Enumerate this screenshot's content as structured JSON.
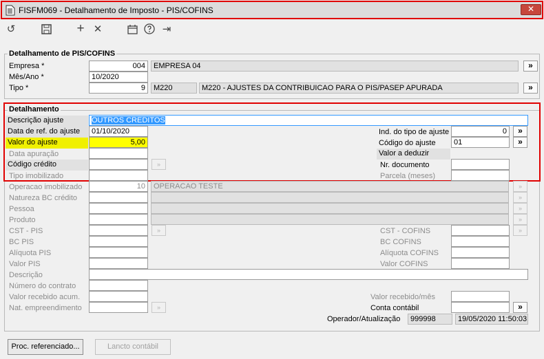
{
  "window": {
    "title": "FISFM069 - Detalhamento de Imposto - PIS/COFINS",
    "close": "✕"
  },
  "toolbar": {
    "undo": "↺",
    "add": "+",
    "delete": "✕",
    "exit": "⇥"
  },
  "header": {
    "legend": "Detalhamento de PIS/COFINS",
    "empresa_label": "Empresa *",
    "empresa_code": "004",
    "empresa_name": "EMPRESA 04",
    "mes_label": "Mês/Ano *",
    "mes_value": "10/2020",
    "tipo_label": "Tipo *",
    "tipo_value": "9",
    "tipo_code": "M220",
    "tipo_desc": "M220 - AJUSTES DA CONTRIBUICAO PARA O PIS/PASEP APURADA",
    "lookup": "»"
  },
  "detail": {
    "legend": "Detalhamento",
    "descricao_label": "Descrição ajuste",
    "descricao_value": "OUTROS CREDITOS",
    "data_ref_label": "Data de ref. do ajuste",
    "data_ref_value": "01/10/2020",
    "valor_label": "Valor do ajuste",
    "valor_value": "5,00",
    "data_apur_label": "Data apuração",
    "cod_credito_label": "Código crédito",
    "tipo_imob_label": "Tipo imobilizado",
    "ind_tipo_label": "Ind. do tipo de ajuste",
    "ind_tipo_value": "0",
    "cod_ajuste_label": "Código do ajuste",
    "cod_ajuste_value": "01",
    "valor_deduzir_label": "Valor a deduzir",
    "nr_doc_label": "Nr. documento",
    "parcela_label": "Parcela (meses)",
    "op_imob_label": "Operacao imobilizado",
    "op_imob_value": "10",
    "op_imob_desc": "OPERACAO TESTE",
    "natureza_label": "Natureza BC crédito",
    "pessoa_label": "Pessoa",
    "produto_label": "Produto",
    "cst_pis_label": "CST - PIS",
    "bc_pis_label": "BC PIS",
    "aliq_pis_label": "Alíquota PIS",
    "valor_pis_label": "Valor PIS",
    "cst_cofins_label": "CST - COFINS",
    "bc_cofins_label": "BC COFINS",
    "aliq_cofins_label": "Alíquota COFINS",
    "valor_cofins_label": "Valor COFINS",
    "descricao2_label": "Descrição",
    "contrato_label": "Número do contrato",
    "recebido_acum_label": "Valor recebido acum.",
    "nat_empre_label": "Nat. empreendimento",
    "recebido_mes_label": "Valor recebido/mês",
    "conta_label": "Conta contábil",
    "operador_label": "Operador/Atualização",
    "operador_value": "999998",
    "atualizacao_value": "19/05/2020 11:50:03"
  },
  "buttons": {
    "proc": "Proc. referenciado...",
    "lancto": "Lancto contábil"
  },
  "colors": {
    "highlight_outline": "#e00000",
    "yellow": "#ffff00",
    "selection": "#3399ff"
  }
}
